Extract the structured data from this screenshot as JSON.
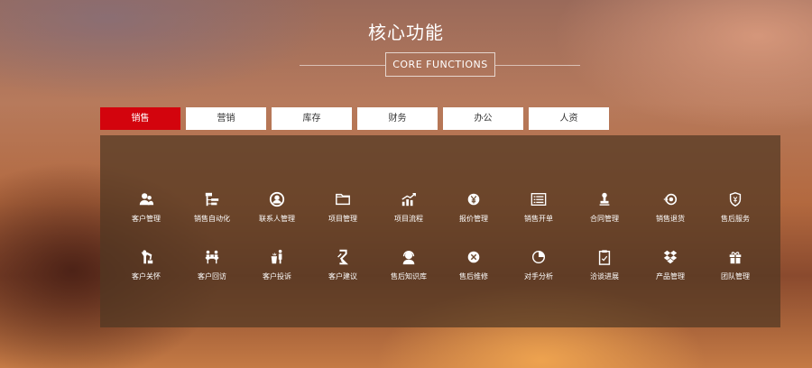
{
  "header": {
    "title": "核心功能",
    "subtitle": "CORE FUNCTIONS"
  },
  "tabs": [
    {
      "label": "销售",
      "active": true
    },
    {
      "label": "营销",
      "active": false
    },
    {
      "label": "库存",
      "active": false
    },
    {
      "label": "财务",
      "active": false
    },
    {
      "label": "办公",
      "active": false
    },
    {
      "label": "人资",
      "active": false
    }
  ],
  "features": {
    "row1": [
      {
        "label": "客户管理",
        "icon": "users-icon"
      },
      {
        "label": "销售自动化",
        "icon": "org-chart-icon"
      },
      {
        "label": "联系人管理",
        "icon": "contact-icon"
      },
      {
        "label": "项目管理",
        "icon": "folder-icon"
      },
      {
        "label": "项目流程",
        "icon": "growth-chart-icon"
      },
      {
        "label": "报价管理",
        "icon": "yen-icon"
      },
      {
        "label": "销售开单",
        "icon": "form-list-icon"
      },
      {
        "label": "合同管理",
        "icon": "stamp-icon"
      },
      {
        "label": "销售退货",
        "icon": "return-icon"
      },
      {
        "label": "售后服务",
        "icon": "shield-icon"
      }
    ],
    "row2": [
      {
        "label": "客户关怀",
        "icon": "care-icon"
      },
      {
        "label": "客户回访",
        "icon": "visit-icon"
      },
      {
        "label": "客户投诉",
        "icon": "complaint-icon"
      },
      {
        "label": "客户建议",
        "icon": "suggestion-icon"
      },
      {
        "label": "售后知识库",
        "icon": "support-agent-icon"
      },
      {
        "label": "售后维修",
        "icon": "tools-icon"
      },
      {
        "label": "对手分析",
        "icon": "pie-chart-icon"
      },
      {
        "label": "洽谈进展",
        "icon": "clipboard-icon"
      },
      {
        "label": "产品管理",
        "icon": "dropbox-icon"
      },
      {
        "label": "团队管理",
        "icon": "gift-icon"
      }
    ]
  },
  "colors": {
    "active_tab": "#d3040d",
    "tab_bg": "#ffffff",
    "panel_bg": "rgba(80,55,35,0.72)"
  }
}
